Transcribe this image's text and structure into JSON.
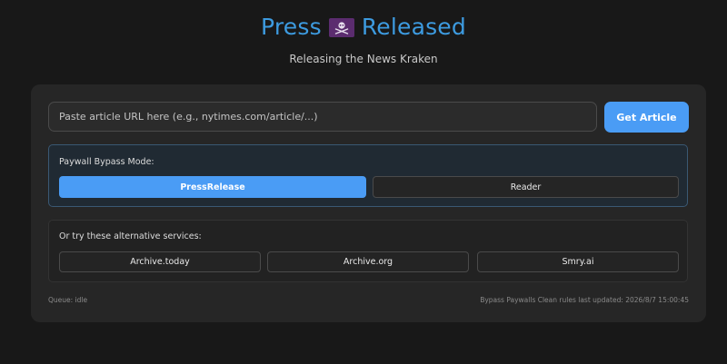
{
  "header": {
    "title_part1": "Press",
    "title_part2": "Released",
    "subtitle": "Releasing the News Kraken",
    "title_color": "#3d9be0",
    "flag_icon": "pirate-flag-icon"
  },
  "search": {
    "placeholder": "Paste article URL here (e.g., nytimes.com/article/...)",
    "value": "",
    "submit_label": "Get Article"
  },
  "mode": {
    "label": "Paywall Bypass Mode:",
    "options": [
      {
        "label": "PressRelease",
        "active": true
      },
      {
        "label": "Reader",
        "active": false
      }
    ]
  },
  "alternatives": {
    "label": "Or try these alternative services:",
    "services": [
      {
        "label": "Archive.today"
      },
      {
        "label": "Archive.org"
      },
      {
        "label": "Smry.ai"
      }
    ]
  },
  "footer": {
    "queue_status": "Queue: idle",
    "rules_updated": "Bypass Paywalls Clean rules last updated: 2026/8/7 15:00:45"
  },
  "colors": {
    "background": "#181818",
    "card": "#262626",
    "accent": "#4a9cf5"
  }
}
